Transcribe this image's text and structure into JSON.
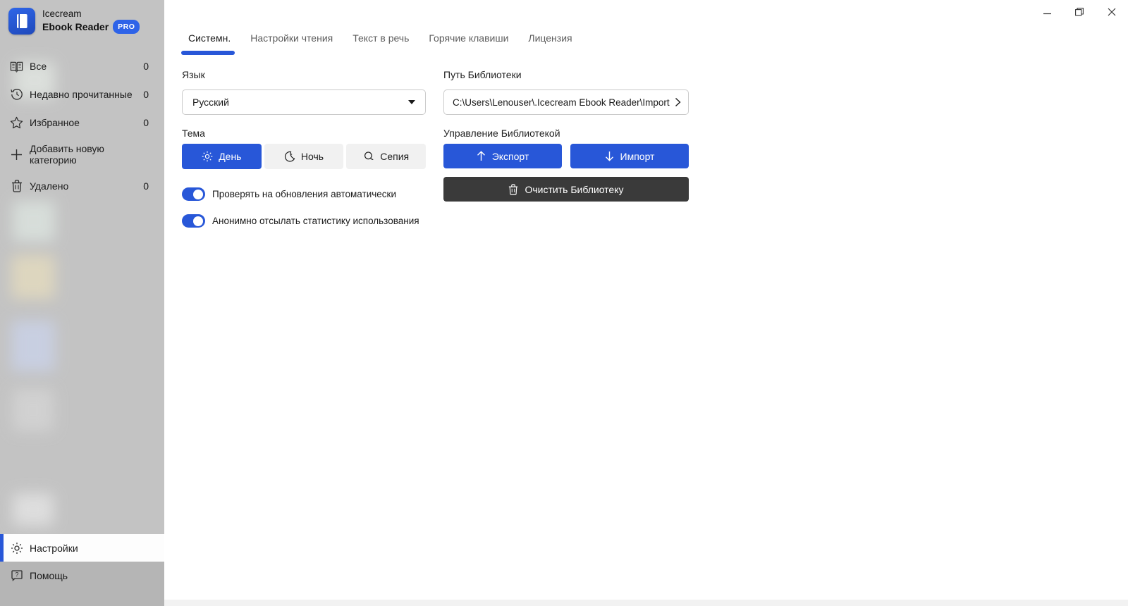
{
  "app": {
    "name_line1": "Icecream",
    "name_line2": "Ebook Reader",
    "badge": "PRO"
  },
  "window_controls": {
    "icons": [
      "minimize-icon",
      "restore-icon",
      "close-icon"
    ]
  },
  "sidebar": {
    "items": [
      {
        "label": "Все",
        "count": "0",
        "icon": "open-book-icon"
      },
      {
        "label": "Недавно прочитанные",
        "count": "0",
        "icon": "history-icon"
      },
      {
        "label": "Избранное",
        "count": "0",
        "icon": "star-icon"
      },
      {
        "label": "Добавить новую категорию",
        "count": "",
        "icon": "plus-icon"
      },
      {
        "label": "Удалено",
        "count": "0",
        "icon": "trash-icon"
      }
    ],
    "bottom": [
      {
        "label": "Настройки",
        "icon": "gear-icon",
        "active": true
      },
      {
        "label": "Помощь",
        "icon": "help-icon",
        "active": false
      }
    ]
  },
  "tabs": [
    {
      "label": "Системн.",
      "active": true
    },
    {
      "label": "Настройки чтения",
      "active": false
    },
    {
      "label": "Текст в речь",
      "active": false
    },
    {
      "label": "Горячие клавиши",
      "active": false
    },
    {
      "label": "Лицензия",
      "active": false
    }
  ],
  "settings": {
    "language": {
      "label": "Язык",
      "value": "Русский"
    },
    "theme": {
      "label": "Тема",
      "options": [
        {
          "label": "День",
          "icon": "sun-icon",
          "active": true
        },
        {
          "label": "Ночь",
          "icon": "moon-icon",
          "active": false
        },
        {
          "label": "Сепия",
          "icon": "sepia-icon",
          "active": false
        }
      ]
    },
    "toggles": [
      {
        "label": "Проверять на обновления автоматически",
        "on": true
      },
      {
        "label": "Анонимно отсылать статистику использования",
        "on": true
      }
    ],
    "library_path": {
      "label": "Путь Библиотеки",
      "value": "C:\\Users\\Lenouser\\.Icecream Ebook Reader\\Import"
    },
    "library_management": {
      "label": "Управление Библиотекой",
      "export_label": "Экспорт",
      "import_label": "Импорт",
      "clear_label": "Очистить Библиотеку"
    }
  },
  "colors": {
    "accent": "#2857d8",
    "badge": "#2e63e8",
    "dark_button": "#3a3a3a",
    "sidebar_bg": "#c3c3c3"
  }
}
